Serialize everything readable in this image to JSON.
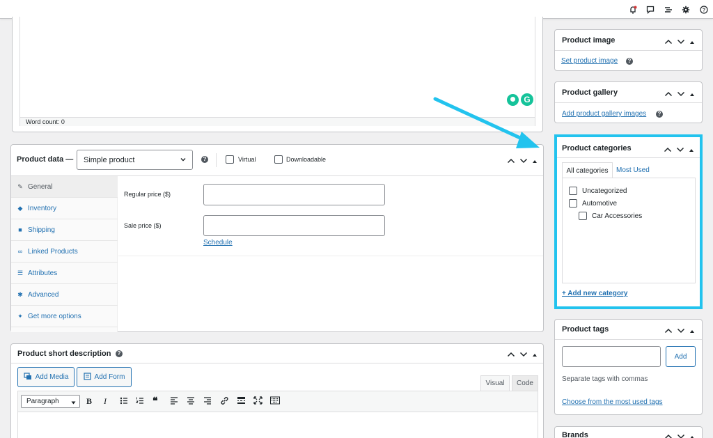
{
  "topbar": {
    "icons": [
      "bell-alert-icon",
      "comment-icon",
      "list-view-icon",
      "settings-gear-icon",
      "help-icon"
    ]
  },
  "editor": {
    "word_count": "Word count: 0"
  },
  "product_data": {
    "title": "Product data —",
    "type_selected": "Simple product",
    "virtual_label": "Virtual",
    "downloadable_label": "Downloadable",
    "tabs": [
      "General",
      "Inventory",
      "Shipping",
      "Linked Products",
      "Attributes",
      "Advanced",
      "Get more options"
    ],
    "regular_price_label": "Regular price ($)",
    "sale_price_label": "Sale price ($)",
    "schedule_link": "Schedule"
  },
  "short_description": {
    "title": "Product short description",
    "add_media": "Add Media",
    "add_form": "Add Form",
    "visual_tab": "Visual",
    "code_tab": "Code",
    "paragraph_select": "Paragraph"
  },
  "product_image": {
    "title": "Product image",
    "link": "Set product image"
  },
  "product_gallery": {
    "title": "Product gallery",
    "link": "Add product gallery images"
  },
  "product_categories": {
    "title": "Product categories",
    "tab_all": "All categories",
    "tab_most_used": "Most Used",
    "items": [
      "Uncategorized",
      "Automotive",
      "Car Accessories"
    ],
    "add_new": "+ Add new category",
    "highlight_color": "#22c3ee"
  },
  "product_tags": {
    "title": "Product tags",
    "add_button": "Add",
    "hint": "Separate tags with commas",
    "choose_link": "Choose from the most used tags"
  },
  "brands": {
    "title": "Brands"
  },
  "annotation": {
    "arrow_color": "#22c3ee"
  }
}
